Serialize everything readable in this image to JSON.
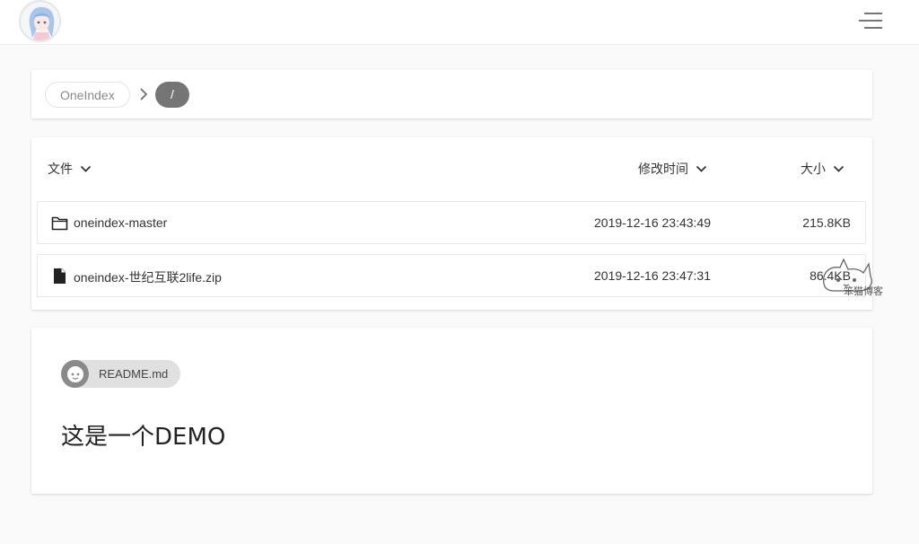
{
  "header": {
    "avatar_icon": "anime-avatar",
    "menu_icon": "hamburger-menu-icon"
  },
  "breadcrumb": {
    "items": [
      {
        "label": "OneIndex"
      },
      {
        "label": "/"
      }
    ]
  },
  "file_list": {
    "columns": [
      {
        "label": "文件"
      },
      {
        "label": "修改时间"
      },
      {
        "label": "大小"
      }
    ],
    "rows": [
      {
        "type": "folder",
        "name": "oneindex-master",
        "modified": "2019-12-16 23:43:49",
        "size": "215.8KB"
      },
      {
        "type": "file",
        "name": "oneindex-世纪互联2life.zip",
        "modified": "2019-12-16 23:47:31",
        "size": "86.4KB"
      }
    ]
  },
  "readme": {
    "chip_label": "README.md",
    "content": "这是一个DEMO"
  },
  "colors": {
    "background": "#fafafa",
    "card": "#ffffff",
    "current_crumb": "#757575",
    "readme_chip": "#e0e0e0"
  }
}
